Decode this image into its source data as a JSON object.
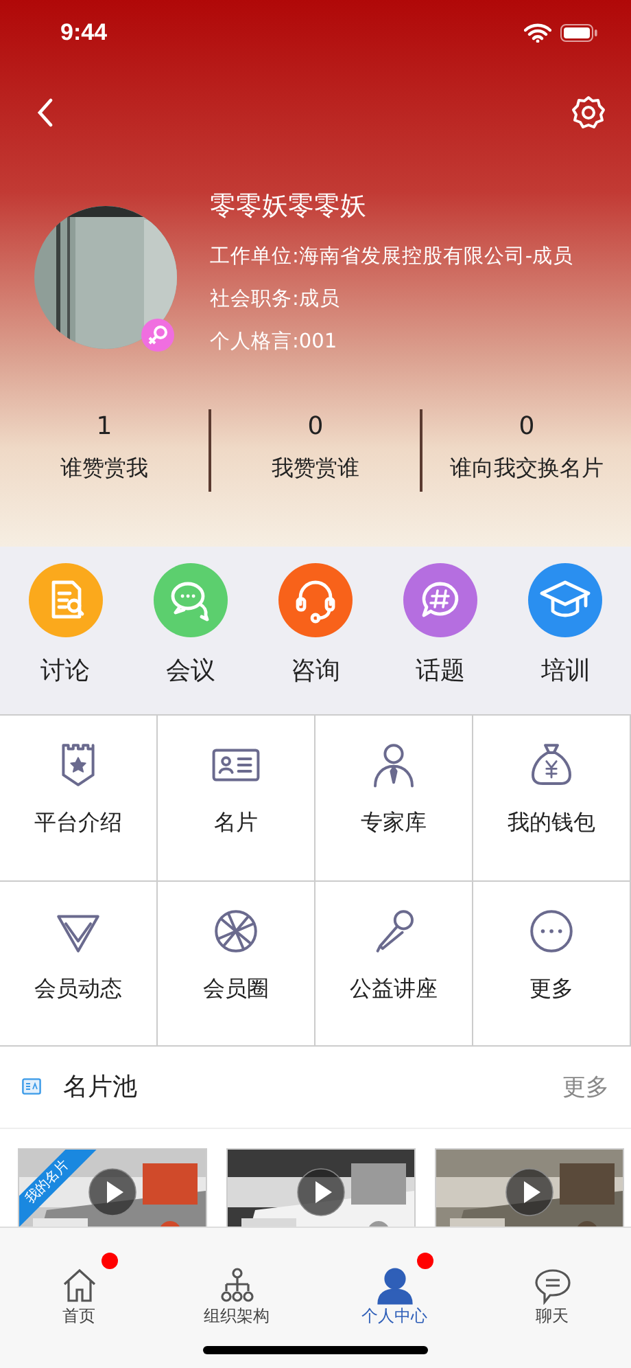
{
  "status_bar": {
    "time": "9:44"
  },
  "profile": {
    "name": "零零妖零零妖",
    "gender_icon": {
      "kind": "female"
    },
    "lines": [
      "工作单位:海南省发展控股有限公司-成员",
      "社会职务:成员",
      "个人格言:001"
    ]
  },
  "stats": [
    {
      "count": "1",
      "label": "谁赞赏我"
    },
    {
      "count": "0",
      "label": "我赞赏谁"
    },
    {
      "count": "0",
      "label": "谁向我交换名片"
    }
  ],
  "quick_actions": [
    {
      "label": "讨论",
      "kind": "document",
      "color": "#fba91c"
    },
    {
      "label": "会议",
      "kind": "chat",
      "color": "#5ccf6e"
    },
    {
      "label": "咨询",
      "kind": "headset",
      "color": "#f8621a"
    },
    {
      "label": "话题",
      "kind": "topic",
      "color": "#b56ee0"
    },
    {
      "label": "培训",
      "kind": "cap",
      "color": "#2a8ff0"
    }
  ],
  "features": [
    {
      "label": "平台介绍",
      "kind": "shield"
    },
    {
      "label": "名片",
      "kind": "card"
    },
    {
      "label": "专家库",
      "kind": "person"
    },
    {
      "label": "我的钱包",
      "kind": "moneybag"
    },
    {
      "label": "会员动态",
      "kind": "diamond"
    },
    {
      "label": "会员圈",
      "kind": "aperture"
    },
    {
      "label": "公益讲座",
      "kind": "microphone"
    },
    {
      "label": "更多",
      "kind": "more"
    }
  ],
  "card_pool": {
    "title": "名片池",
    "more": "更多",
    "cards": [
      {
        "kind": "picture",
        "tag": "我的名片"
      },
      {
        "kind": "picture"
      },
      {
        "kind": "picture"
      }
    ]
  },
  "tab_bar": [
    {
      "label": "首页",
      "kind": "home",
      "selected": false,
      "badge": true
    },
    {
      "label": "组织架构",
      "kind": "org",
      "selected": false,
      "badge": false
    },
    {
      "label": "个人中心",
      "kind": "user",
      "selected": true,
      "badge": true
    },
    {
      "label": "聊天",
      "kind": "chat",
      "selected": false,
      "badge": false
    }
  ]
}
